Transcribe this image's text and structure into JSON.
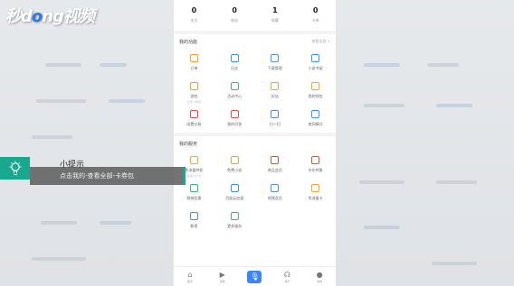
{
  "watermark": {
    "brand_a": "秒",
    "brand_b": "d",
    "brand_c": "o",
    "brand_d": "ng",
    "brand_e": "视频"
  },
  "stats": [
    {
      "value": "0",
      "label": "关注"
    },
    {
      "value": "0",
      "label": "粉丝"
    },
    {
      "value": "1",
      "label": "收藏"
    },
    {
      "value": "0",
      "label": "卡券"
    }
  ],
  "my_features": {
    "title": "我的功能",
    "more": "查看全部 >",
    "items": [
      {
        "label": "订单",
        "sub": "",
        "color": "#f5a623"
      },
      {
        "label": "历史",
        "sub": "",
        "color": "#4a90e2"
      },
      {
        "label": "下载管理",
        "sub": "",
        "color": "#4a90e2"
      },
      {
        "label": "小说书架",
        "sub": "",
        "color": "#4a90e2"
      },
      {
        "label": "游戏",
        "sub": "享受小游戏",
        "color": "#f5a623"
      },
      {
        "label": "活动中心",
        "sub": "",
        "color": "#3cb878"
      },
      {
        "label": "好店",
        "sub": "",
        "color": "#f5a623"
      },
      {
        "label": "我的钱包",
        "sub": "",
        "color": "#f5a623"
      },
      {
        "label": "闲置交易",
        "sub": "",
        "color": "#e74c3c"
      },
      {
        "label": "我的问答",
        "sub": "",
        "color": "#e74c3c"
      },
      {
        "label": "扫一扫",
        "sub": "",
        "color": "#4a90e2"
      },
      {
        "label": "夜间模式",
        "sub": "",
        "color": "#4a90e2"
      }
    ]
  },
  "my_services": {
    "title": "我的服务",
    "items": [
      {
        "label": "免流量特权",
        "sub": "联通大王卡",
        "color": "#f5a623"
      },
      {
        "label": "免费小说",
        "sub": "",
        "color": "#f5a623"
      },
      {
        "label": "商品会员",
        "sub": "",
        "color": "#e74c3c"
      },
      {
        "label": "京东特惠",
        "sub": "",
        "color": "#e74c3c"
      },
      {
        "label": "商城优惠",
        "sub": "",
        "color": "#3cb878"
      },
      {
        "label": "百度云加速",
        "sub": "",
        "color": "#4a90e2"
      },
      {
        "label": "视频会员",
        "sub": "",
        "color": "#4a90e2"
      },
      {
        "label": "免流量卡",
        "sub": "",
        "color": "#f5a623"
      },
      {
        "label": "影视",
        "sub": "",
        "color": "#4a90e2"
      },
      {
        "label": "更多服务",
        "sub": "",
        "color": "#3cb878"
      }
    ]
  },
  "tabbar": [
    {
      "label": "首页",
      "glyph": "⌂",
      "icon": "home-icon"
    },
    {
      "label": "视频",
      "glyph": "▶",
      "icon": "play-icon"
    },
    {
      "label": "",
      "glyph": "🎙",
      "icon": "microphone-icon"
    },
    {
      "label": "音乐",
      "glyph": "☊",
      "icon": "headphones-icon"
    },
    {
      "label": "我的",
      "glyph": "●",
      "icon": "profile-icon"
    }
  ],
  "tip": {
    "title": "小提示",
    "text": "点击我的-查看全部-卡券包",
    "icon": "lightbulb-icon"
  },
  "colors": {
    "accent": "#1aa78f",
    "primary": "#3a84ff"
  }
}
